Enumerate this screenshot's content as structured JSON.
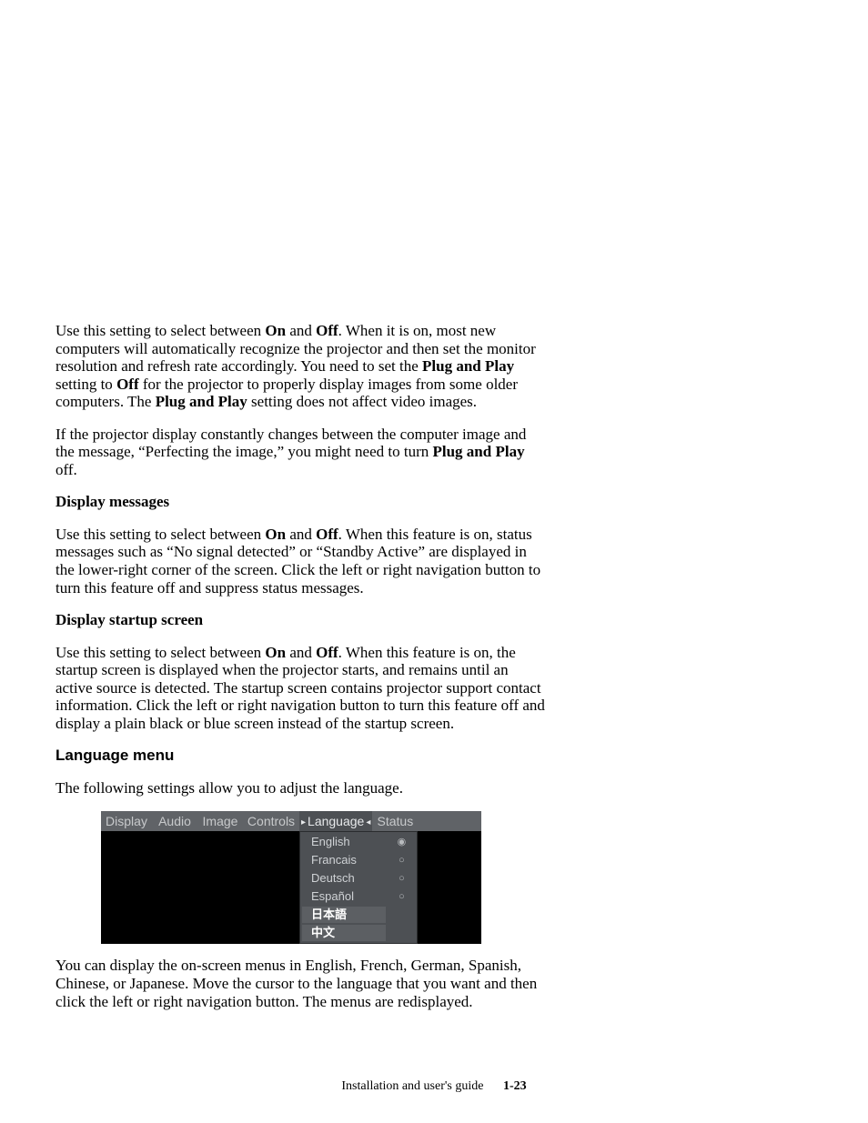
{
  "para1": {
    "t1": "Use this setting to select between ",
    "b1": "On",
    "t2": " and ",
    "b2": "Off",
    "t3": ". When it is on, most new computers will automatically recognize the projector and then set the monitor resolution and refresh rate accordingly. You need to set the ",
    "b3": "Plug and Play",
    "t4": " setting to ",
    "b4": "Off",
    "t5": " for the projector to properly display images from some older computers. The ",
    "b5": "Plug and Play",
    "t6": " setting does not affect video images."
  },
  "para2": {
    "t1": "If the projector display constantly changes between the computer image and the message, “Perfecting the image,” you might need to turn ",
    "b1": "Plug and Play",
    "t2": " off."
  },
  "head1": "Display messages",
  "para3": {
    "t1": "Use this setting to select between ",
    "b1": "On",
    "t2": " and ",
    "b2": "Off",
    "t3": ". When this feature is on, status messages such as “No signal detected” or “Standby Active” are displayed in the lower-right corner of the screen. Click the left or right navigation button to turn this feature off and suppress status messages."
  },
  "head2": "Display startup screen",
  "para4": {
    "t1": "Use this setting to select between ",
    "b1": "On",
    "t2": " and ",
    "b2": "Off",
    "t3": ". When this feature is on, the startup screen is displayed when the projector starts, and remains until an active source is detected. The startup screen contains projector support contact information. Click the left or right navigation button to turn this feature off and display a plain black or blue screen instead of the startup screen."
  },
  "sectionHead": "Language menu",
  "para5": "The following settings allow you to adjust the language.",
  "menu": {
    "tabs": [
      "Display",
      "Audio",
      "Image",
      "Controls",
      "Language",
      "Status"
    ],
    "selectedTabIndex": 4,
    "items": [
      {
        "label": "English",
        "selected": true,
        "bright": false
      },
      {
        "label": "Francais",
        "selected": false,
        "bright": false
      },
      {
        "label": "Deutsch",
        "selected": false,
        "bright": false
      },
      {
        "label": "Español",
        "selected": false,
        "bright": false
      },
      {
        "label": "日本語",
        "selected": null,
        "bright": true
      },
      {
        "label": "中文",
        "selected": null,
        "bright": true
      }
    ]
  },
  "para6": "You can display the on-screen menus in English, French, German, Spanish, Chinese, or Japanese. Move the cursor to the language that you want and then click the left or right navigation button. The menus are redisplayed.",
  "footer": {
    "label": "Installation and user's guide",
    "page": "1-23"
  }
}
